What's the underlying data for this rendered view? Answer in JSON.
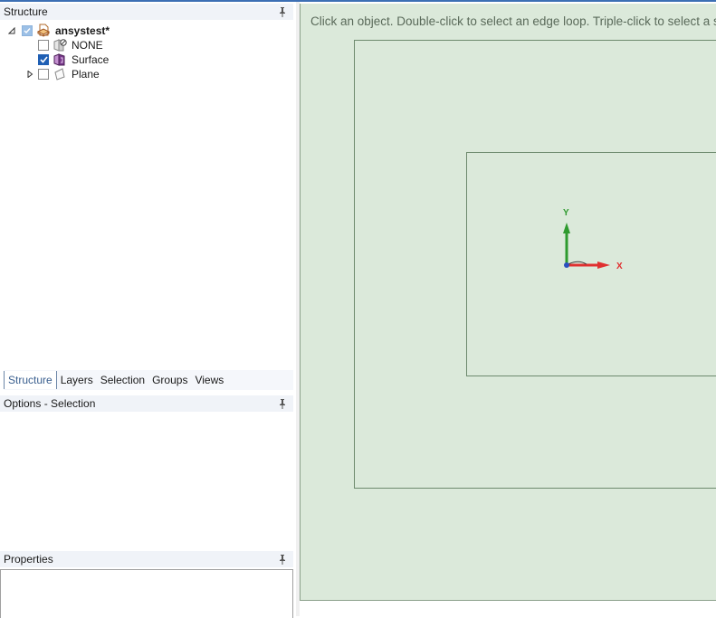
{
  "structure_panel": {
    "title": "Structure",
    "tree": [
      {
        "label": "ansystest*",
        "icon": "document-icon",
        "checked": "partial",
        "expanded": true,
        "bold": true
      },
      {
        "label": "NONE",
        "icon": "component-icon",
        "checked": false
      },
      {
        "label": "Surface",
        "icon": "surface-body-icon",
        "checked": true
      },
      {
        "label": "Plane",
        "icon": "plane-icon",
        "checked": false,
        "expandable": true
      }
    ]
  },
  "tabs": [
    "Structure",
    "Layers",
    "Selection",
    "Groups",
    "Views"
  ],
  "active_tab": "Structure",
  "options_panel": {
    "title": "Options - Selection"
  },
  "properties_panel": {
    "title": "Properties"
  },
  "viewport": {
    "hint": "Click an object. Double-click to select an edge loop. Triple-click to select a so",
    "axes": {
      "x_label": "X",
      "y_label": "Y"
    },
    "colors": {
      "background": "#dbe9da",
      "x_axis": "#e03030",
      "y_axis": "#2e9a2e",
      "origin": "#2a4fc0"
    }
  }
}
